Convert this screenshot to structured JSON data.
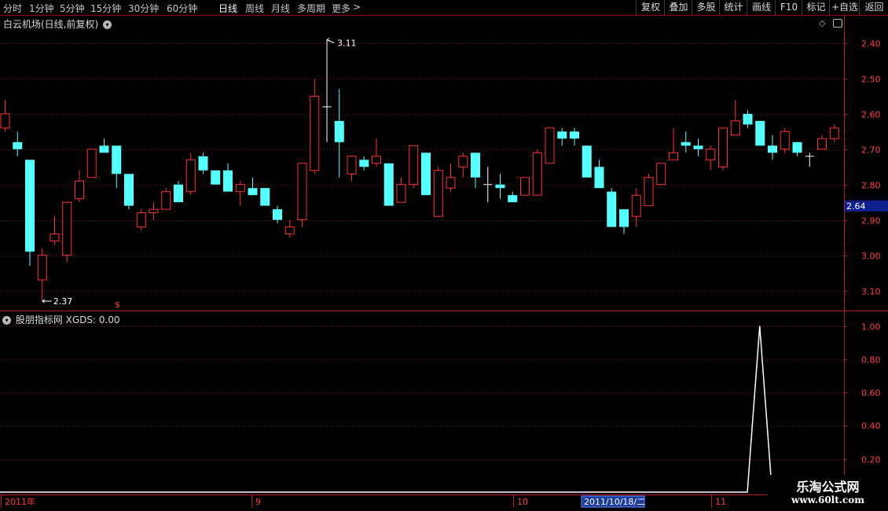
{
  "toolbar": {
    "periods": [
      "分时",
      "1分钟",
      "5分钟",
      "15分钟",
      "30分钟",
      "60分钟",
      "日线",
      "周线",
      "月线",
      "多周期",
      "更多"
    ],
    "active_period": "日线",
    "more_arrow": ">",
    "buttons": [
      "复权",
      "叠加",
      "多股",
      "统计",
      "画线",
      "F10",
      "标记",
      "+自选",
      "返回"
    ]
  },
  "main_panel": {
    "title": "白云机场(日线,前复权)",
    "current_price_label": "2.64",
    "high_annotation": "3.11",
    "low_annotation": "2.37",
    "marker_glyph": "$",
    "y_ticks": [
      "3.10",
      "3.00",
      "2.90",
      "2.80",
      "2.70",
      "2.60",
      "2.50",
      "2.40"
    ]
  },
  "indicator_panel": {
    "title": "股朋指标网 XGDS: 0.00",
    "y_ticks": [
      "1.00",
      "0.80",
      "0.60",
      "0.40",
      "0.20"
    ]
  },
  "x_axis": {
    "labels": [
      "2011年",
      "9",
      "10",
      "11"
    ],
    "cursor_date": "2011/10/18/二"
  },
  "watermark": {
    "title": "乐淘公式网",
    "url": "www.60lt.com"
  },
  "colors": {
    "up": "#ff3232",
    "down": "#54ffff",
    "flat": "#ffffff",
    "axis": "#b0201e",
    "grid": "#7a1a18",
    "price_badge": "#0c1f8f"
  },
  "chart_data": [
    {
      "type": "candlestick",
      "title": "白云机场(日线,前复权)",
      "ylim": [
        2.35,
        3.14
      ],
      "yticks": [
        2.4,
        2.5,
        2.6,
        2.7,
        2.8,
        2.9,
        3.0,
        3.1
      ],
      "last_price": 2.64,
      "x_labels": [
        "2011年",
        "9",
        "10",
        "11"
      ],
      "ohlc": [
        [
          2.86,
          2.94,
          2.85,
          2.9
        ],
        [
          2.82,
          2.85,
          2.78,
          2.8
        ],
        [
          2.77,
          2.77,
          2.47,
          2.51
        ],
        [
          2.43,
          2.52,
          2.37,
          2.5
        ],
        [
          2.54,
          2.61,
          2.53,
          2.56
        ],
        [
          2.5,
          2.65,
          2.48,
          2.65
        ],
        [
          2.66,
          2.74,
          2.65,
          2.71
        ],
        [
          2.72,
          2.8,
          2.72,
          2.8
        ],
        [
          2.81,
          2.83,
          2.79,
          2.79
        ],
        [
          2.81,
          2.81,
          2.69,
          2.73
        ],
        [
          2.73,
          2.73,
          2.63,
          2.64
        ],
        [
          2.58,
          2.63,
          2.57,
          2.62
        ],
        [
          2.62,
          2.65,
          2.6,
          2.63
        ],
        [
          2.63,
          2.69,
          2.63,
          2.68
        ],
        [
          2.7,
          2.71,
          2.65,
          2.65
        ],
        [
          2.68,
          2.79,
          2.67,
          2.77
        ],
        [
          2.78,
          2.79,
          2.73,
          2.74
        ],
        [
          2.74,
          2.74,
          2.7,
          2.7
        ],
        [
          2.74,
          2.76,
          2.68,
          2.68
        ],
        [
          2.68,
          2.71,
          2.64,
          2.7
        ],
        [
          2.69,
          2.72,
          2.67,
          2.67
        ],
        [
          2.69,
          2.69,
          2.64,
          2.64
        ],
        [
          2.63,
          2.64,
          2.59,
          2.6
        ],
        [
          2.56,
          2.6,
          2.55,
          2.58
        ],
        [
          2.6,
          2.76,
          2.58,
          2.76
        ],
        [
          2.74,
          3.0,
          2.73,
          2.95
        ],
        [
          2.92,
          3.11,
          2.82,
          2.92
        ],
        [
          2.88,
          2.97,
          2.72,
          2.82
        ],
        [
          2.73,
          2.78,
          2.71,
          2.78
        ],
        [
          2.77,
          2.78,
          2.74,
          2.75
        ],
        [
          2.76,
          2.83,
          2.75,
          2.78
        ],
        [
          2.76,
          2.76,
          2.64,
          2.64
        ],
        [
          2.65,
          2.72,
          2.65,
          2.7
        ],
        [
          2.7,
          2.81,
          2.69,
          2.81
        ],
        [
          2.79,
          2.79,
          2.67,
          2.67
        ],
        [
          2.61,
          2.75,
          2.61,
          2.74
        ],
        [
          2.69,
          2.76,
          2.68,
          2.72
        ],
        [
          2.75,
          2.79,
          2.72,
          2.78
        ],
        [
          2.79,
          2.79,
          2.69,
          2.72
        ],
        [
          2.7,
          2.75,
          2.65,
          2.7
        ],
        [
          2.7,
          2.73,
          2.66,
          2.69
        ],
        [
          2.67,
          2.68,
          2.65,
          2.65
        ],
        [
          2.67,
          2.72,
          2.67,
          2.72
        ],
        [
          2.67,
          2.8,
          2.67,
          2.79
        ],
        [
          2.76,
          2.86,
          2.76,
          2.86
        ],
        [
          2.85,
          2.86,
          2.81,
          2.83
        ],
        [
          2.85,
          2.86,
          2.81,
          2.83
        ],
        [
          2.81,
          2.81,
          2.72,
          2.72
        ],
        [
          2.75,
          2.77,
          2.69,
          2.69
        ],
        [
          2.68,
          2.69,
          2.58,
          2.58
        ],
        [
          2.63,
          2.63,
          2.56,
          2.58
        ],
        [
          2.61,
          2.69,
          2.58,
          2.67
        ],
        [
          2.64,
          2.73,
          2.64,
          2.72
        ],
        [
          2.7,
          2.75,
          2.7,
          2.76
        ],
        [
          2.77,
          2.86,
          2.77,
          2.79
        ],
        [
          2.82,
          2.85,
          2.79,
          2.81
        ],
        [
          2.81,
          2.83,
          2.78,
          2.8
        ],
        [
          2.77,
          2.81,
          2.74,
          2.8
        ],
        [
          2.75,
          2.86,
          2.74,
          2.86
        ],
        [
          2.84,
          2.94,
          2.84,
          2.88
        ],
        [
          2.9,
          2.91,
          2.86,
          2.87
        ],
        [
          2.88,
          2.88,
          2.81,
          2.81
        ],
        [
          2.81,
          2.84,
          2.77,
          2.79
        ],
        [
          2.8,
          2.86,
          2.79,
          2.85
        ],
        [
          2.82,
          2.82,
          2.78,
          2.79
        ],
        [
          2.78,
          2.79,
          2.75,
          2.78
        ],
        [
          2.8,
          2.84,
          2.8,
          2.83
        ],
        [
          2.83,
          2.87,
          2.82,
          2.86
        ]
      ]
    },
    {
      "type": "line",
      "title": "股朋指标网 XGDS: 0.00",
      "ylim": [
        0.0,
        1.06
      ],
      "yticks": [
        1.0,
        0.8,
        0.6,
        0.4,
        0.2
      ],
      "series": [
        {
          "values": [
            0,
            0,
            0,
            0,
            0,
            0,
            0,
            0,
            0,
            0,
            0,
            0,
            0,
            0,
            0,
            0,
            0,
            0,
            0,
            0,
            0,
            0,
            0,
            0,
            0,
            0,
            0,
            0,
            0,
            0,
            0,
            0,
            0,
            0,
            0,
            0,
            0,
            0,
            0,
            0,
            0,
            0,
            0,
            0,
            0,
            0,
            0,
            0,
            0,
            0,
            0,
            0,
            0,
            0,
            0,
            0,
            0,
            0,
            0,
            0,
            0,
            1,
            0,
            0,
            0,
            0,
            0,
            0
          ]
        }
      ]
    }
  ]
}
